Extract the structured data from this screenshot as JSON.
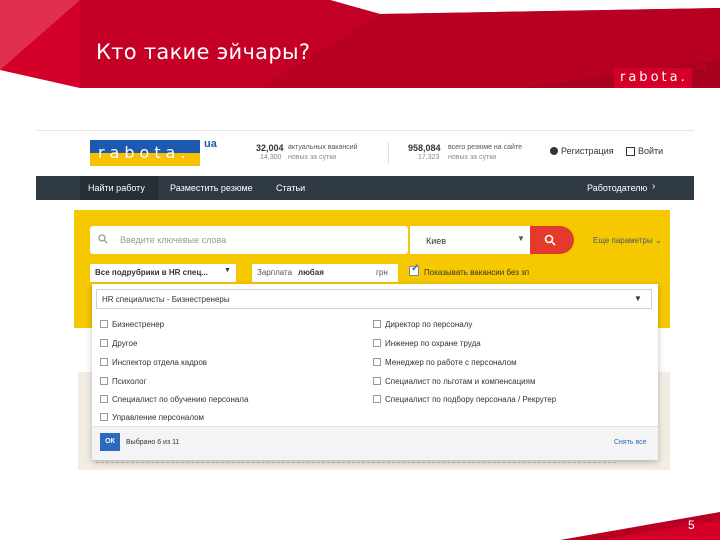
{
  "slide": {
    "title": "Кто такие эйчары?",
    "corner_logo": "rabota.",
    "corner_logo_suffix": "ua",
    "page_number": "5",
    "accent_color": "#d4002a"
  },
  "site": {
    "logo_text": "rabota.",
    "logo_suffix": "ua",
    "stats": [
      {
        "number": "32,004",
        "label": "актуальных вакансий",
        "sub_number": "14,300",
        "sub_label": "новых за сутки"
      },
      {
        "number": "958,084",
        "label": "всего резюме на сайте",
        "sub_number": "17,323",
        "sub_label": "новых за сутки"
      }
    ],
    "register_label": "Регистрация",
    "login_label": "Войти",
    "brand_blue": "#1d58b1",
    "brand_yellow": "#f6c200"
  },
  "nav": {
    "items": [
      "Найти работу",
      "Разместить резюме",
      "Статьи"
    ],
    "employer_label": "Работодателю",
    "bar_color": "#303a44"
  },
  "search": {
    "keywords_placeholder": "Введите ключевые слова",
    "city": "Киев",
    "more_params": "Еще параметры",
    "rubric": "Все подрубрики в HR спец...",
    "salary_label": "Зарплата",
    "salary_value": "любая",
    "salary_unit": "грн",
    "show_label": "Показывать вакансии без зп",
    "band_color": "#f6c800",
    "button_color": "#e23a2b"
  },
  "dropdown": {
    "selected_category": "HR специалисты - Бизнестренеры",
    "options_left": [
      "Бизнестренер",
      "Другое",
      "Инспектор отдела кадров",
      "Психолог",
      "Специалист по обучению персонала",
      "Управление персоналом"
    ],
    "options_right": [
      "Директор по персоналу",
      "Инженер по охране труда",
      "Менеджер по работе с персоналом",
      "Специалист по льготам и компенсациям",
      "Специалист по подбору персонала / Рекрутер"
    ],
    "ok_label": "ОК",
    "selected_count": "Выбрано 6 из 11",
    "deselect_all": "Снять все"
  }
}
